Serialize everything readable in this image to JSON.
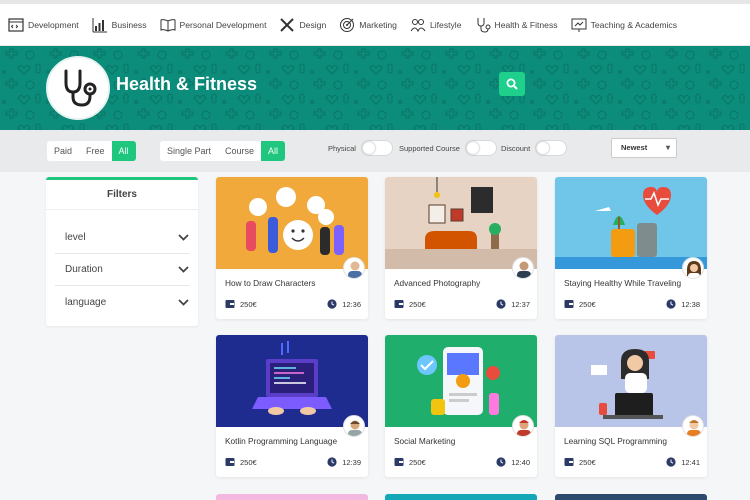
{
  "nav": [
    {
      "label": "Development",
      "icon": "code-window-icon"
    },
    {
      "label": "Business",
      "icon": "bar-chart-icon"
    },
    {
      "label": "Personal Development",
      "icon": "open-book-icon"
    },
    {
      "label": "Design",
      "icon": "tools-icon"
    },
    {
      "label": "Marketing",
      "icon": "target-icon"
    },
    {
      "label": "Lifestyle",
      "icon": "people-icon"
    },
    {
      "label": "Health & Fitness",
      "icon": "stethoscope-icon"
    },
    {
      "label": "Teaching & Academics",
      "icon": "presentation-icon"
    }
  ],
  "hero": {
    "title": "Health & Fitness",
    "icon": "stethoscope-icon",
    "background": "#0c8c7a",
    "search_icon": "search-icon"
  },
  "price_filter": {
    "options": [
      "Paid",
      "Free",
      "All"
    ],
    "selected": "All"
  },
  "type_filter": {
    "options": [
      "Single Part",
      "Course",
      "All"
    ],
    "selected": "All"
  },
  "toggles": [
    {
      "label": "Physical",
      "on": false
    },
    {
      "label": "Supported Course",
      "on": false
    },
    {
      "label": "Discount",
      "on": false
    }
  ],
  "sort": {
    "selected": "Newest"
  },
  "filters": {
    "title": "Filters",
    "rows": [
      "level",
      "Duration",
      "language"
    ]
  },
  "courses": [
    {
      "title": "How to Draw Characters",
      "price": "250€",
      "duration": "12:36"
    },
    {
      "title": "Advanced Photography",
      "price": "250€",
      "duration": "12:37"
    },
    {
      "title": "Staying Healthy While Traveling",
      "price": "250€",
      "duration": "12:38"
    },
    {
      "title": "Kotlin Programming Language",
      "price": "250€",
      "duration": "12:39"
    },
    {
      "title": "Social Marketing",
      "price": "250€",
      "duration": "12:40"
    },
    {
      "title": "Learning SQL Programming",
      "price": "250€",
      "duration": "12:41"
    }
  ],
  "colors": {
    "accent": "#1ec67e",
    "teal": "#0c8c7a"
  }
}
